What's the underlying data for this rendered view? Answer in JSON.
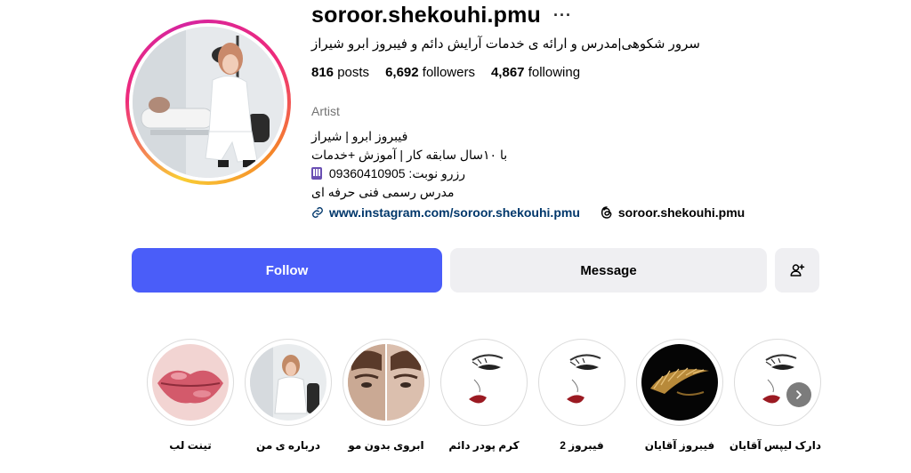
{
  "profile": {
    "username": "soroor.shekouhi.pmu",
    "more_glyph": "···",
    "full_name": "سرور شکوهی|مدرس و ارائه ی خدمات آرایش دائم و فیبروز ابرو شیراز",
    "stats": {
      "posts_count": "816",
      "posts_label": "posts",
      "followers_count": "6,692",
      "followers_label": "followers",
      "following_count": "4,867",
      "following_label": "following"
    },
    "category": "Artist",
    "bio": {
      "line1": "فیبروز ابرو | شیراز",
      "line2": "با ۱۰سال سابقه کار | آموزش +خدمات",
      "line3": "رزرو نوبت: 09360410905",
      "line4": "مدرس رسمی فنی حرفه ای"
    },
    "website": "www.instagram.com/soroor.shekouhi.pmu",
    "threads_handle": "soroor.shekouhi.pmu"
  },
  "actions": {
    "follow_label": "Follow",
    "message_label": "Message",
    "suggest_icon": "person-add-icon"
  },
  "colors": {
    "follow_blue": "#4a5df9",
    "link_blue": "#00376b",
    "secondary_button": "#efeff2",
    "muted_text": "#737373"
  },
  "highlights": [
    {
      "label": "تینت لب",
      "icon": "lips-photo"
    },
    {
      "label": "درباره ی من",
      "icon": "portrait-photo"
    },
    {
      "label": "ابروی بدون مو",
      "icon": "face-photo"
    },
    {
      "label": "کرم پودر دائم",
      "icon": "face-sketch"
    },
    {
      "label": "فیبروز 2",
      "icon": "face-sketch"
    },
    {
      "label": "فیبروز آقایان",
      "icon": "gold-brow"
    },
    {
      "label": "دارک لیپس آقایان",
      "icon": "face-sketch"
    }
  ]
}
